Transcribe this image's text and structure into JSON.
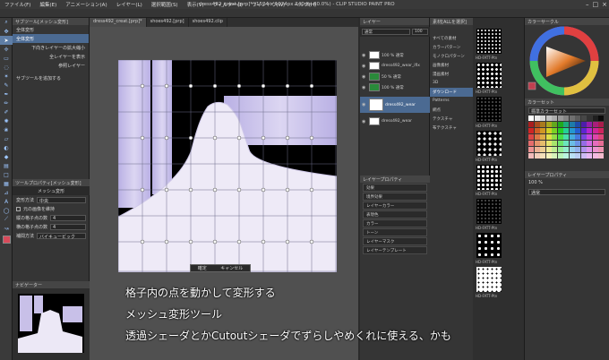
{
  "app": {
    "title": "dress492_creat.[prp]* (1524 x 1024px 240dpi 80.0%) - CLIP STUDIO PAINT PRO"
  },
  "menu": [
    "ファイル(F)",
    "編集(E)",
    "アニメーション(A)",
    "レイヤー(L)",
    "選択範囲(S)",
    "表示(V)",
    "フィルター(I)",
    "ウィンドウ(W)",
    "ヘルプ(H)"
  ],
  "subtool": {
    "header": "サブツール[メッシュ変形]",
    "items": [
      {
        "label": "全体変形",
        "selected": false
      },
      {
        "label": "全体変形",
        "selected": true
      },
      {
        "label": "下向きレイヤーの拡大縮小",
        "selected": false
      },
      {
        "label": "全レイヤーを表示",
        "selected": false
      },
      {
        "label": "参照レイヤー",
        "selected": false
      },
      {
        "label": "サブツールを追加する",
        "selected": false
      }
    ]
  },
  "tool_property": {
    "header": "ツールプロパティ[メッシュ変形]",
    "title": "メッシュ変形",
    "rows": [
      {
        "label": "変形方法",
        "value": "中央"
      },
      {
        "label": "縦の格子点の数",
        "value": "4"
      },
      {
        "label": "横の格子点の数",
        "value": "4"
      },
      {
        "label": "補間方法",
        "value": "バイキュービック"
      }
    ],
    "checks": [
      "元の画像を維持"
    ]
  },
  "navigator_header": "ナビゲーター",
  "canvas": {
    "tabs": [
      "dress492_creat.[prp]*",
      "shoes492.[prp]",
      "shoes492.clip"
    ],
    "confirm_label": "確定",
    "cancel_label": "キャンセル"
  },
  "layers": {
    "header": "レイヤー",
    "mode": "通常",
    "opacity": "100",
    "items": [
      {
        "name": "100 % 通常",
        "sub": "dress492_wear_ifix",
        "selected": false
      },
      {
        "name": "100 % 通常",
        "sub": "",
        "selected": false
      },
      {
        "name": "50 % 通常",
        "sub": "",
        "selected": false
      },
      {
        "name": "100 % 通常",
        "sub": "",
        "selected": false
      },
      {
        "name": "100 % 通常",
        "sub": "dress492_wear",
        "selected": true
      },
      {
        "name": "100 % 通常",
        "sub": "dress492_wear",
        "selected": false
      }
    ]
  },
  "layer_property": {
    "header": "レイヤープロパティ",
    "buttons": [
      "効果",
      "境界効果",
      "レイヤーカラー",
      "表現色",
      "カラー",
      "トーン",
      "レイヤーマスク",
      "レイヤーテンプレート"
    ]
  },
  "materials": {
    "header": "素材[ALLを選択]",
    "items": [
      {
        "label": "すべての素材",
        "selected": false
      },
      {
        "label": "カラーパターン",
        "selected": false
      },
      {
        "label": "モノクロパターン",
        "selected": false
      },
      {
        "label": "画像素材",
        "selected": false
      },
      {
        "label": "漫画素材",
        "selected": false
      },
      {
        "label": "3D",
        "selected": false
      },
      {
        "label": "ダウンロード",
        "selected": true
      },
      {
        "label": "Patterns",
        "selected": false
      },
      {
        "label": "網点",
        "selected": false
      },
      {
        "label": "テクスチャ",
        "selected": false
      },
      {
        "label": "布テクスチャ",
        "selected": false
      }
    ]
  },
  "tones": {
    "labels": [
      "HD-FATT-Ptn",
      "HD-FATT-Ptn",
      "HD-FATT-Ptn",
      "HD-FATT-Ptn",
      "HD-FATT-Ptn",
      "HD-FATT-Ptn",
      "HD-FATT-Ptn",
      "HD-FATT-Ptn",
      "HD-FATT-Ptn",
      "HD-FATT-Ptn"
    ]
  },
  "color": {
    "header": "カラーサークル",
    "set_header": "カラーセット",
    "set_name": "標準カラーセット",
    "info_header": "レイヤープロパティ",
    "percent_label": "100 %",
    "blend_mode": "通常"
  },
  "subtitles": [
    "格子内の点を動かして変形する",
    "メッシュ変形ツール",
    "透過シェーダとかCutoutシェーダでずらしやめくれに使える、かも"
  ]
}
